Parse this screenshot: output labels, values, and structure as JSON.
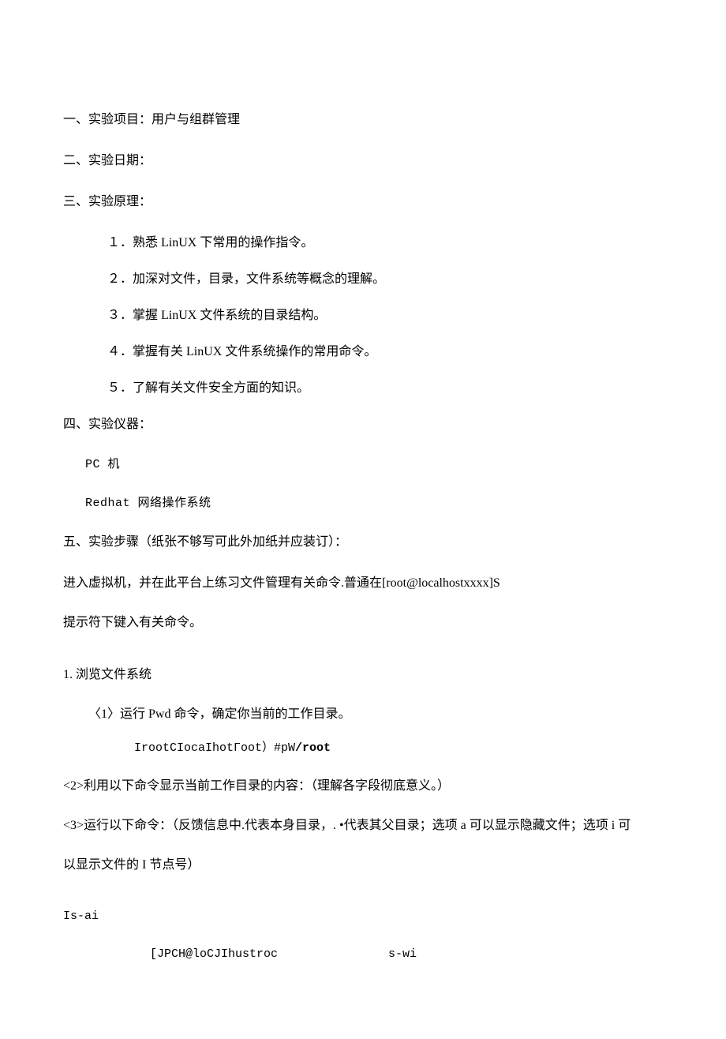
{
  "sections": {
    "s1": "一、实验项目：用户与组群管理",
    "s2": "二、实验日期：",
    "s3": "三、实验原理：",
    "s4": "四、实验仪器：",
    "s5": "五、实验步骤（纸张不够写可此外加纸并应装订）："
  },
  "principles": {
    "p1": "１．熟悉 LinUX 下常用的操作指令。",
    "p2": "２．加深对文件，目录，文件系统等概念的理解。",
    "p3": "３．掌握 LinUX 文件系统的目录结构。",
    "p4": "４．掌握有关 LinUX 文件系统操作的常用命令。",
    "p5": "５．了解有关文件安全方面的知识。"
  },
  "instruments": {
    "i1": "PC 机",
    "i2": "Redhat 网络操作系统"
  },
  "steps_intro": {
    "l1": "进入虚拟机，并在此平台上练习文件管理有关命令.普通在[root@localhostxxxx]S",
    "l2": "提示符下键入有关命令。"
  },
  "step1": {
    "title": "1.   浏览文件系统",
    "sub1": "〈1〉运行 Pwd 命令，确定你当前的工作目录。",
    "cmd1_prefix": "IrootCIocaIhotΓoot）#pW",
    "cmd1_bold": "/root",
    "sub2": "<2>利用以下命令显示当前工作目录的内容：（理解各字段彻底意义。）",
    "sub3": "<3>运行以下命令：（反馈信息中.代表本身目录，. •代表其父目录；选项 a 可以显示隐藏文件；选项 i 可",
    "sub3b": "以显示文件的 I 节点号）",
    "cmd2": "Is-ai",
    "tail_a": "[JPCH@loCJIhustroc",
    "tail_b": "s-wi"
  }
}
